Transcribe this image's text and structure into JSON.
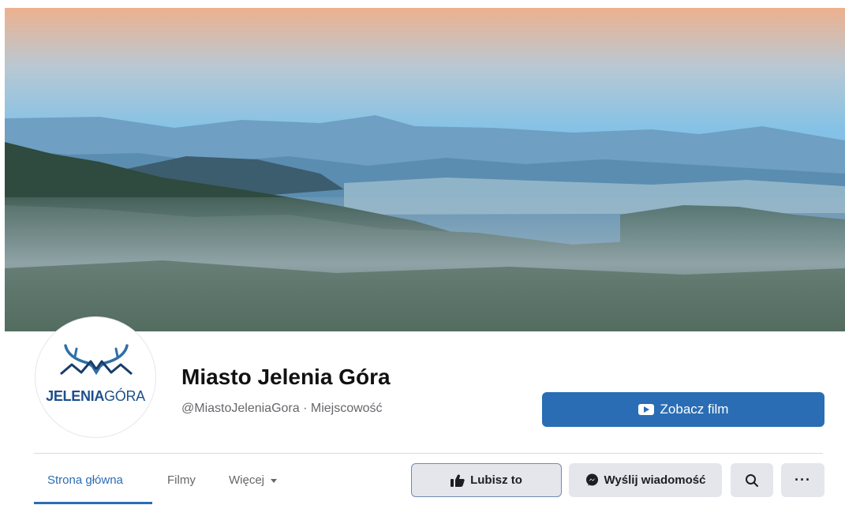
{
  "page": {
    "name": "Miasto Jelenia Góra",
    "handle_category": "@MiastoJeleniaGora · Miejscowość"
  },
  "avatar": {
    "logo_bold": "JELENIA",
    "logo_light": "GÓRA"
  },
  "cta": {
    "label": "Zobacz film",
    "icon": "play-video-icon"
  },
  "tabs": [
    {
      "label": "Strona główna",
      "active": true
    },
    {
      "label": "Filmy",
      "active": false
    },
    {
      "label": "Więcej",
      "active": false,
      "has_dropdown": true
    }
  ],
  "actions": {
    "like_label": "Lubisz to",
    "message_label": "Wyślij wiadomość",
    "search_icon": "search-icon",
    "more_label": "···"
  },
  "colors": {
    "accent": "#2a6db4",
    "button_bg": "#e4e6eb",
    "muted_text": "#65676b"
  }
}
